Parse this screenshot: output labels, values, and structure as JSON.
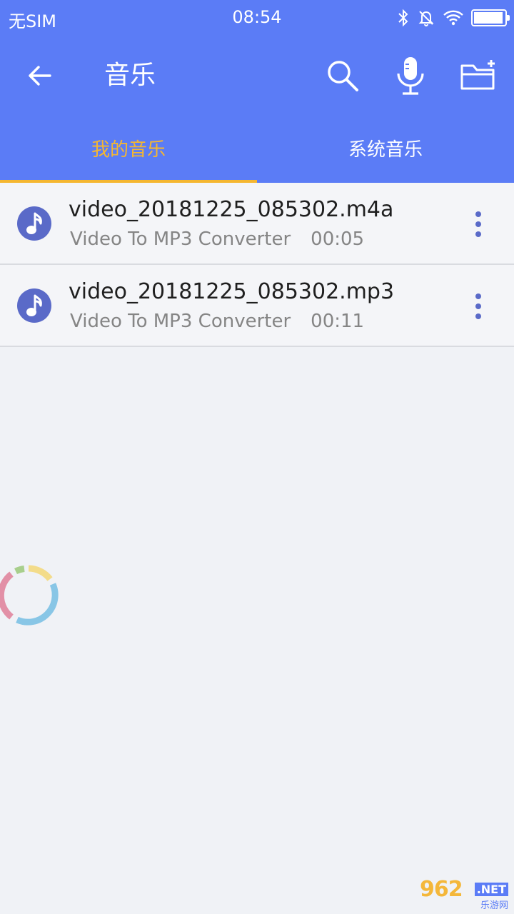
{
  "status_bar": {
    "carrier": "无SIM",
    "time": "08:54"
  },
  "toolbar": {
    "title": "音乐",
    "back_icon": "arrow-left-icon",
    "actions": [
      "search-icon",
      "microphone-icon",
      "folder-add-icon"
    ]
  },
  "tabs": [
    {
      "label": "我的音乐",
      "active": true
    },
    {
      "label": "系统音乐",
      "active": false
    }
  ],
  "files": [
    {
      "name": "video_20181225_085302.m4a",
      "source": "Video To MP3 Converter",
      "duration": "00:05"
    },
    {
      "name": "video_20181225_085302.mp3",
      "source": "Video To MP3 Converter",
      "duration": "00:11"
    }
  ],
  "watermark": {
    "number": "962",
    "suffix": ".NET",
    "caption": "乐游网"
  },
  "colors": {
    "primary": "#5b7cf6",
    "accent": "#f5b731",
    "icon": "#5a6ac8",
    "background": "#f0f2f6"
  }
}
